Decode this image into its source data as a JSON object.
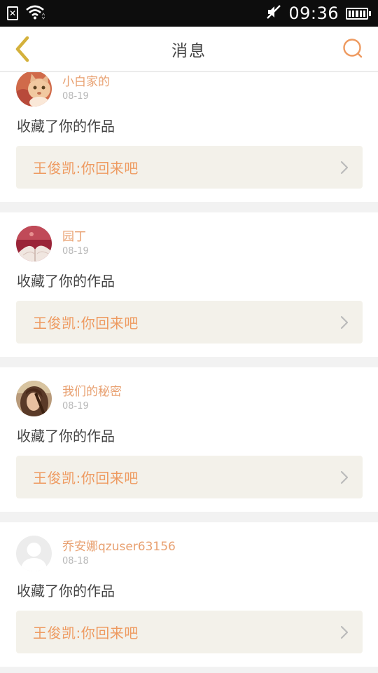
{
  "status_bar": {
    "time": "09:36",
    "icons": [
      "sim-card-icon",
      "wifi-icon",
      "mute-icon",
      "battery-icon"
    ]
  },
  "header": {
    "title": "消息",
    "back_icon": "chevron-left-icon",
    "search_icon": "search-icon"
  },
  "colors": {
    "accent": "#ee9a60",
    "username": "#e8a070",
    "back_chevron": "#d4b13c",
    "card_link_bg": "#f3f1ea"
  },
  "messages": [
    {
      "username": "小白家的",
      "date": "08-19",
      "action": "收藏了你的作品",
      "work_title": "王俊凯:你回来吧",
      "avatar": "cat-photo-avatar"
    },
    {
      "username": "园丁",
      "date": "08-19",
      "action": "收藏了你的作品",
      "work_title": "王俊凯:你回来吧",
      "avatar": "book-photo-avatar"
    },
    {
      "username": "我们的秘密",
      "date": "08-19",
      "action": "收藏了你的作品",
      "work_title": "王俊凯:你回来吧",
      "avatar": "girl-photo-avatar"
    },
    {
      "username": "乔安娜qzuser63156",
      "date": "08-18",
      "action": "收藏了你的作品",
      "work_title": "王俊凯:你回来吧",
      "avatar": "default-user-avatar"
    }
  ]
}
